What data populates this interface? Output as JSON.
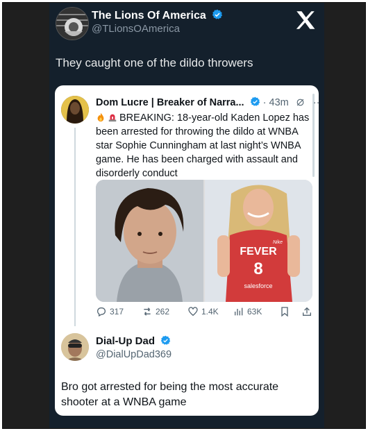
{
  "post": {
    "author_name": "The Lions Of America",
    "author_handle": "@TLionsOAmerica",
    "text": "They caught one of the dildo throwers"
  },
  "quote": {
    "author_name": "Dom Lucre | Breaker of Narra...",
    "time": "43m",
    "text": "BREAKING: 18-year-old Kaden Lopez has been arrested for throwing the dildo at WNBA star Sophie Cunningham at last night’s WNBA game. He has been charged with assault and disorderly conduct",
    "jersey_team": "FEVER",
    "jersey_number": "8",
    "jersey_sponsor": "salesforce",
    "jersey_brand": "Nike",
    "stats": {
      "replies": "317",
      "reposts": "262",
      "likes": "1.4K",
      "views": "63K"
    }
  },
  "reply": {
    "author_name": "Dial-Up Dad",
    "author_handle": "@DialUpDad369",
    "text": "Bro got arrested for being the most accurate shooter at a WNBA game"
  },
  "colors": {
    "verified": "#1d9bf0",
    "dark_bg": "#14202c",
    "jersey": "#d23b3b"
  },
  "icons": [
    "verified-icon",
    "x-logo-icon",
    "grok-icon",
    "more-icon",
    "reply-icon",
    "repost-icon",
    "like-icon",
    "views-icon",
    "bookmark-icon",
    "share-icon",
    "fire-icon",
    "siren-icon"
  ]
}
